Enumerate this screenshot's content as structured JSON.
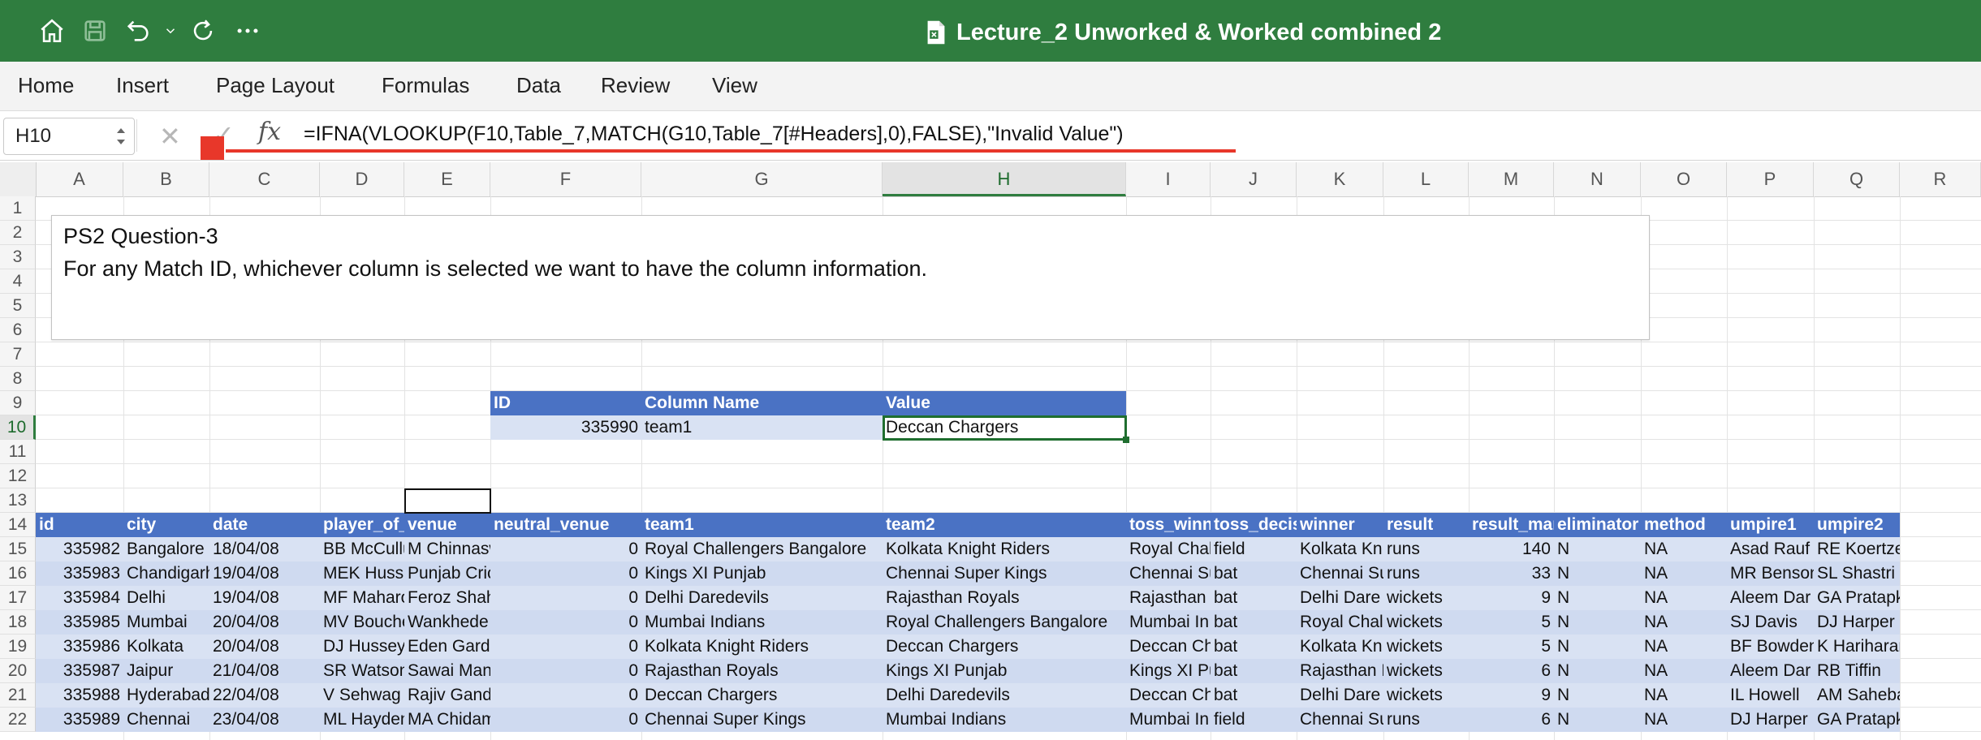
{
  "app": {
    "title": "Lecture_2 Unworked & Worked combined 2",
    "title_icon": "excel-document-icon",
    "accent": "#2f7d3f"
  },
  "ribbon": {
    "tabs": [
      "Home",
      "Insert",
      "Page Layout",
      "Formulas",
      "Data",
      "Review",
      "View"
    ]
  },
  "formula_bar": {
    "name_box": "H10",
    "cancel_symbol": "✕",
    "enter_symbol": "✓",
    "fx_label": "fx",
    "formula": "=IFNA(VLOOKUP(F10,Table_7,MATCH(G10,Table_7[#Headers],0),FALSE),\"Invalid Value\")"
  },
  "columns": [
    "A",
    "B",
    "C",
    "D",
    "E",
    "F",
    "G",
    "H",
    "I",
    "J",
    "K",
    "L",
    "M",
    "N",
    "O",
    "P",
    "Q",
    "R"
  ],
  "rows": [
    "1",
    "2",
    "3",
    "4",
    "5",
    "6",
    "7",
    "8",
    "9",
    "10",
    "11",
    "12",
    "13",
    "14",
    "15",
    "16",
    "17",
    "18",
    "19",
    "20",
    "21",
    "22"
  ],
  "selected": {
    "column": "H",
    "row": "10"
  },
  "textbox": {
    "line1": "PS2 Question-3",
    "line2": "For any Match ID, whichever column is selected we want to have the column information."
  },
  "lookup": {
    "headers": [
      "ID",
      "Column Name",
      "Value"
    ],
    "id": "335990",
    "column_name": "team1",
    "value": "Deccan Chargers"
  },
  "table": {
    "headers": [
      "id",
      "city",
      "date",
      "player_of_m",
      "venue",
      "neutral_venue",
      "team1",
      "team2",
      "toss_winne",
      "toss_decisi",
      "winner",
      "result",
      "result_mar",
      "eliminator",
      "method",
      "umpire1",
      "umpire2"
    ],
    "rows": [
      [
        "335982",
        "Bangalore",
        "18/04/08",
        "BB McCullu",
        "M Chinnasw",
        "0",
        "Royal Challengers Bangalore",
        "Kolkata Knight Riders",
        "Royal Chall",
        "field",
        "Kolkata Kni",
        "runs",
        "140",
        "N",
        "NA",
        "Asad Rauf",
        "RE Koertzen"
      ],
      [
        "335983",
        "Chandigarh",
        "19/04/08",
        "MEK Hussey",
        "Punjab Cric",
        "0",
        "Kings XI Punjab",
        "Chennai Super Kings",
        "Chennai Su",
        "bat",
        "Chennai Su",
        "runs",
        "33",
        "N",
        "NA",
        "MR Benson",
        "SL Shastri"
      ],
      [
        "335984",
        "Delhi",
        "19/04/08",
        "MF Maharo",
        "Feroz Shah",
        "0",
        "Delhi Daredevils",
        "Rajasthan Royals",
        "Rajasthan F",
        "bat",
        "Delhi Dare",
        "wickets",
        "9",
        "N",
        "NA",
        "Aleem Dar",
        "GA Pratapkumar"
      ],
      [
        "335985",
        "Mumbai",
        "20/04/08",
        "MV Bouche",
        "Wankhede",
        "0",
        "Mumbai Indians",
        "Royal Challengers Bangalore",
        "Mumbai In",
        "bat",
        "Royal Chall",
        "wickets",
        "5",
        "N",
        "NA",
        "SJ Davis",
        "DJ Harper"
      ],
      [
        "335986",
        "Kolkata",
        "20/04/08",
        "DJ Hussey",
        "Eden Garde",
        "0",
        "Kolkata Knight Riders",
        "Deccan Chargers",
        "Deccan Cha",
        "bat",
        "Kolkata Kni",
        "wickets",
        "5",
        "N",
        "NA",
        "BF Bowden",
        "K Hariharan"
      ],
      [
        "335987",
        "Jaipur",
        "21/04/08",
        "SR Watson",
        "Sawai Mans",
        "0",
        "Rajasthan Royals",
        "Kings XI Punjab",
        "Kings XI Pu",
        "bat",
        "Rajasthan F",
        "wickets",
        "6",
        "N",
        "NA",
        "Aleem Dar",
        "RB Tiffin"
      ],
      [
        "335988",
        "Hyderabad",
        "22/04/08",
        "V Sehwag",
        "Rajiv Gandl",
        "0",
        "Deccan Chargers",
        "Delhi Daredevils",
        "Deccan Cha",
        "bat",
        "Delhi Dare",
        "wickets",
        "9",
        "N",
        "NA",
        "IL Howell",
        "AM Saheba"
      ],
      [
        "335989",
        "Chennai",
        "23/04/08",
        "ML Hayden",
        "MA Chidam",
        "0",
        "Chennai Super Kings",
        "Mumbai Indians",
        "Mumbai In",
        "field",
        "Chennai Su",
        "runs",
        "6",
        "N",
        "NA",
        "DJ Harper",
        "GA Pratapkumar"
      ]
    ]
  }
}
